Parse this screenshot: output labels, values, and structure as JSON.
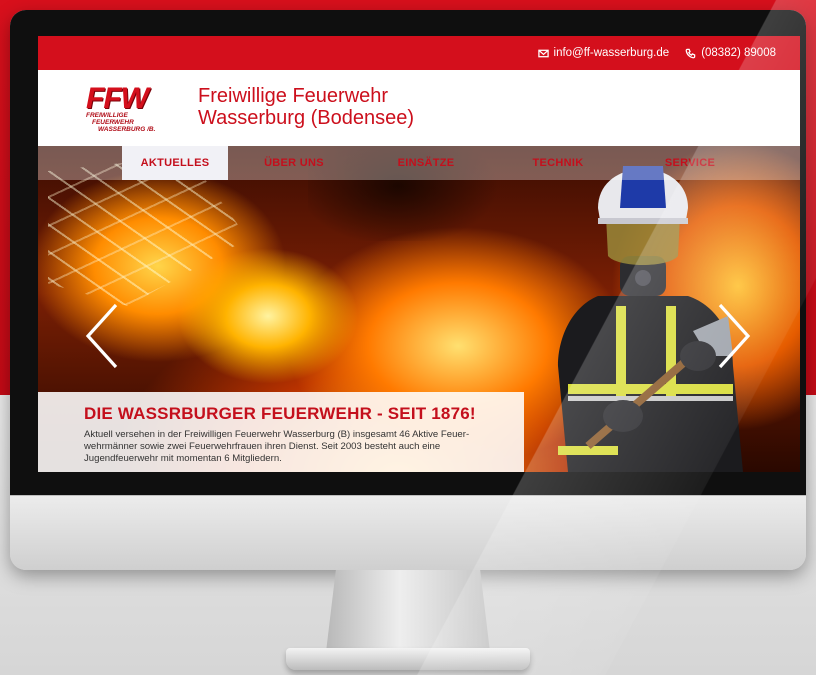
{
  "topbar": {
    "email": "info@ff-wasserburg.de",
    "phone": "(08382) 89008",
    "email_icon": "envelope-icon",
    "phone_icon": "phone-icon"
  },
  "logo": {
    "mark": "FFW",
    "line1": "FREIWILLIGE",
    "line2": "FEUERWEHR",
    "line3": "WASSERBURG /B."
  },
  "site_title": {
    "line1": "Freiwillige Feuerwehr",
    "line2": "Wasserburg (Bodensee)"
  },
  "nav": [
    {
      "label": "AKTUELLES",
      "active": true
    },
    {
      "label": "ÜBER UNS",
      "active": false
    },
    {
      "label": "EINSÄTZE",
      "active": false
    },
    {
      "label": "TECHNIK",
      "active": false
    },
    {
      "label": "SERVICE",
      "active": false
    }
  ],
  "slider": {
    "prev_icon": "chevron-left-icon",
    "next_icon": "chevron-right-icon",
    "headline": "DIE WASSRBURGER FEUERWEHR - SEIT 1876!",
    "text": "Aktuell versehen in der Freiwilligen Feuerwehr Wasserburg (B) insgesamt 46 Aktive Feuer-wehrmänner sowie zwei Feuerwehrfrauen ihren Dienst. Seit 2003 besteht auch eine Jugendfeuerwehr mit momentan 6 Mitgliedern."
  },
  "colors": {
    "brand_red": "#d40f1c",
    "background_red": "#c40a16"
  }
}
